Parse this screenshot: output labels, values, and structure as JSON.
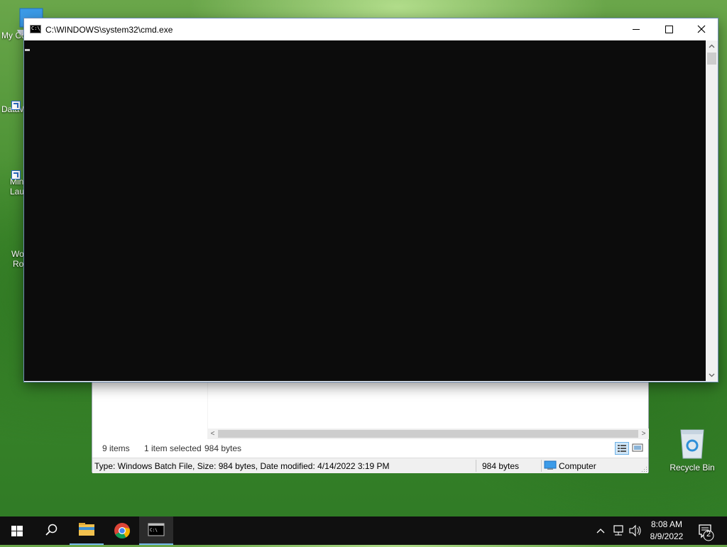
{
  "desktop": {
    "icons": [
      {
        "label": "My Co"
      },
      {
        "label": "DataW"
      },
      {
        "label_line1": "Min",
        "label_line2": "Lau"
      },
      {
        "label_line1": "Wo",
        "label_line2": "Rol"
      },
      {
        "label": "Recycle Bin"
      }
    ]
  },
  "cmd_window": {
    "title": "C:\\WINDOWS\\system32\\cmd.exe",
    "icon_text": "C:\\_",
    "buttons": {
      "minimize": "—",
      "maximize": "☐",
      "close": "✕"
    },
    "scroll_up": "▲",
    "scroll_down": "▼"
  },
  "explorer_window": {
    "status": {
      "item_count": "9 items",
      "selected": "1 item selected",
      "selected_size": "984 bytes"
    },
    "details": {
      "info": "Type: Windows Batch File, Size: 984 bytes, Date modified: 4/14/2022 3:19 PM",
      "size": "984 bytes",
      "location": "Computer"
    },
    "scroll_left": "<",
    "scroll_right": ">"
  },
  "taskbar": {
    "start": "start-icon",
    "search": "search-icon",
    "apps": [
      "file-explorer",
      "chrome",
      "command-prompt"
    ],
    "clock": {
      "time": "8:08 AM",
      "date": "8/9/2022"
    },
    "notification_count": "2"
  },
  "colors": {
    "console_bg": "#0c0c0c",
    "taskbar_bg": "#101010",
    "accent": "#76b9ed"
  }
}
